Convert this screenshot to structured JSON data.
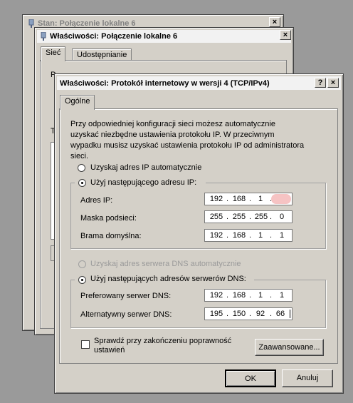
{
  "win_status": {
    "title": "Stan: Połączenie lokalne 6"
  },
  "win_props": {
    "title": "Właściwości: Połączenie lokalne 6",
    "tabs": [
      "Sieć",
      "Udostępnianie"
    ],
    "partial_label_1": "P",
    "partial_label_2": "T"
  },
  "dialog": {
    "title": "Właściwości: Protokół internetowy w wersji 4 (TCP/IPv4)",
    "help_btn": "?",
    "close_btn": "×",
    "tab": "Ogólne",
    "description": "Przy odpowiedniej konfiguracji sieci możesz automatycznie uzyskać niezbędne ustawienia protokołu IP. W przeciwnym wypadku musisz uzyskać ustawienia protokołu IP od administratora sieci.",
    "ip_auto": "Uzyskaj adres IP automatycznie",
    "ip_manual": "Użyj następującego adresu IP:",
    "ip_address_label": "Adres IP:",
    "ip_address": [
      "192",
      "168",
      "1",
      ""
    ],
    "subnet_label": "Maska podsieci:",
    "subnet": [
      "255",
      "255",
      "255",
      "0"
    ],
    "gateway_label": "Brama domyślna:",
    "gateway": [
      "192",
      "168",
      "1",
      "1"
    ],
    "dns_auto": "Uzyskaj adres serwera DNS automatycznie",
    "dns_manual": "Użyj następujących adresów serwerów DNS:",
    "dns_pref_label": "Preferowany serwer DNS:",
    "dns_pref": [
      "192",
      "168",
      "1",
      "1"
    ],
    "dns_alt_label": "Alternatywny serwer DNS:",
    "dns_alt": [
      "195",
      "150",
      "92",
      "66"
    ],
    "validate_label": "Sprawdź przy zakończeniu poprawność ustawień",
    "advanced_btn": "Zaawansowane...",
    "ok_btn": "OK",
    "cancel_btn": "Anuluj"
  },
  "colors": {
    "redaction": "#f4b8b8"
  }
}
